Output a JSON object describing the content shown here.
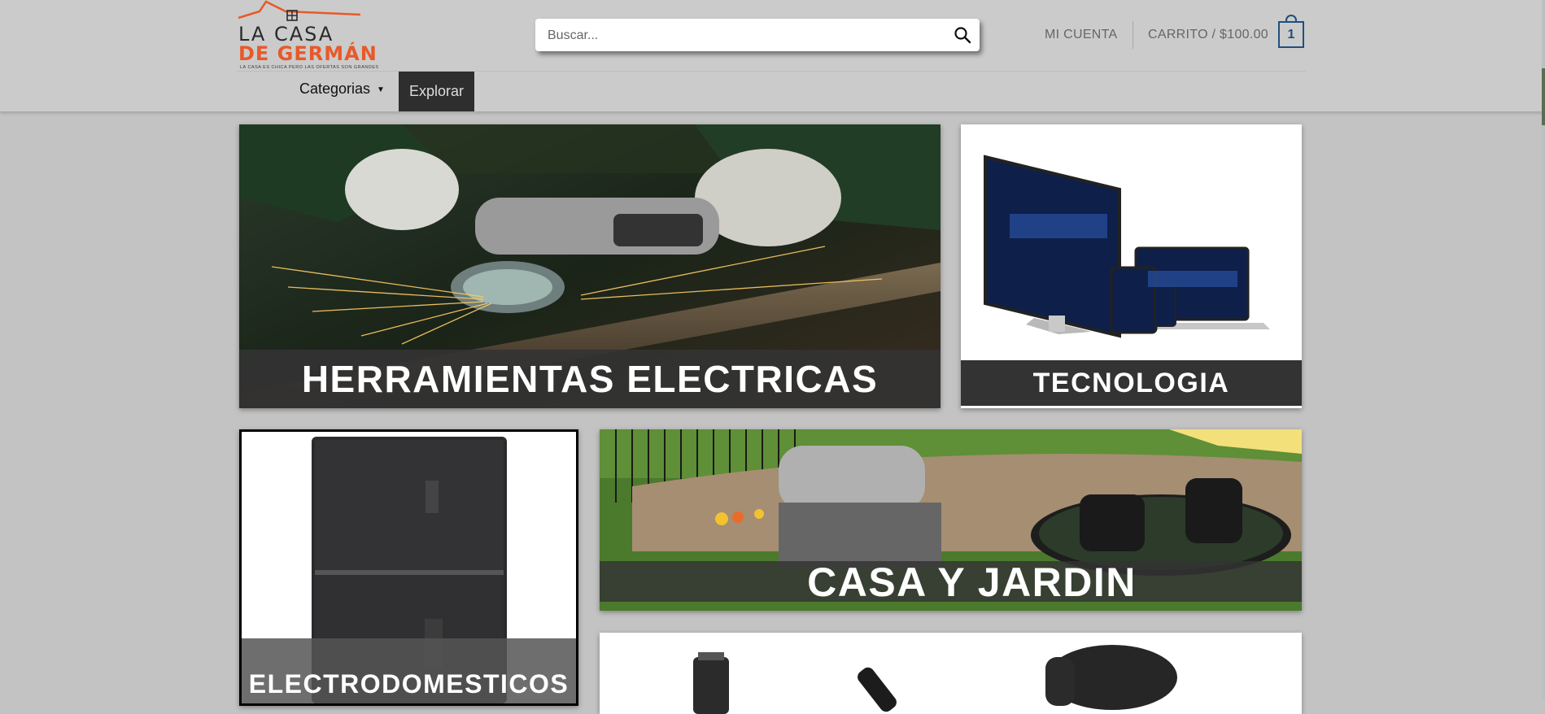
{
  "header": {
    "logo": {
      "line1": "LA CASA",
      "line2": "DE GERMÁN",
      "tagline": "LA CASA ES CHICA PERO LAS OFERTAS SON GRANDES"
    },
    "search": {
      "placeholder": "Buscar..."
    },
    "account_label": "MI CUENTA",
    "cart_label": "CARRITO / $100.00",
    "cart_count": "1"
  },
  "nav": {
    "categories_label": "Categorias",
    "explore_label": "Explorar"
  },
  "categories": [
    {
      "label": "HERRAMIENTAS ELECTRICAS"
    },
    {
      "label": "TECNOLOGIA"
    },
    {
      "label": "ELECTRODOMESTICOS"
    },
    {
      "label": "CASA Y JARDIN"
    }
  ],
  "colors": {
    "brand_orange": "#e8592a",
    "cart_blue": "#1f4f7d",
    "header_bg": "#cbcbcb",
    "page_bg": "#c3c3c3",
    "label_overlay": "#333333"
  },
  "icons": {
    "search": "search-icon",
    "cart": "shopping-bag-icon",
    "dropdown": "caret-down-icon"
  }
}
